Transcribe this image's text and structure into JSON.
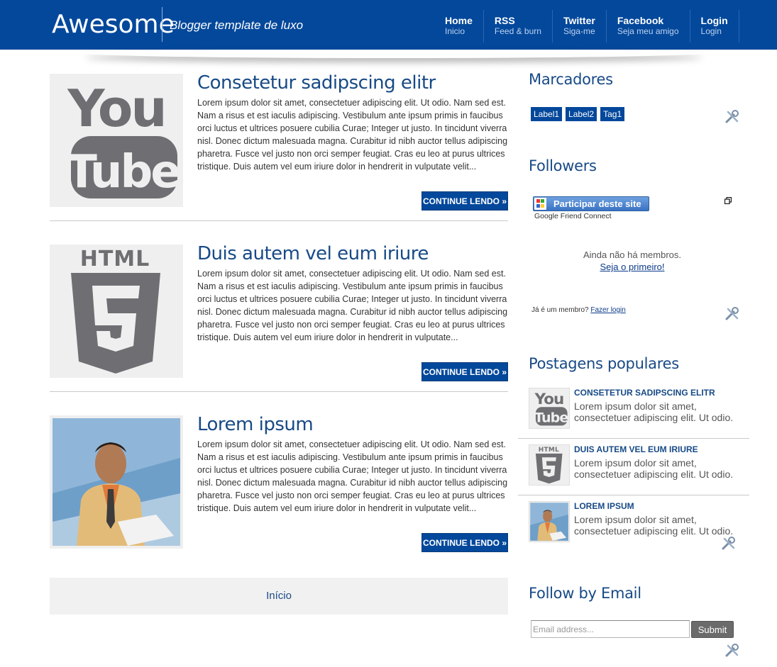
{
  "header": {
    "brand": "Awesome",
    "tagline": "Blogger template de luxo",
    "nav": [
      {
        "title": "Home",
        "subtitle": "Inicio"
      },
      {
        "title": "RSS",
        "subtitle": "Feed & burn"
      },
      {
        "title": "Twitter",
        "subtitle": "Siga-me"
      },
      {
        "title": "Facebook",
        "subtitle": "Seja meu amigo"
      },
      {
        "title": "Login",
        "subtitle": "Login"
      }
    ]
  },
  "posts": [
    {
      "title": "Consetetur sadipscing elitr",
      "thumb_icon": "youtube-logo-icon",
      "body": "Lorem ipsum dolor sit amet, consectetuer adipiscing elit. Ut odio. Nam sed est. Nam a risus et est iaculis adipiscing. Vestibulum ante ipsum primis in faucibus orci luctus et ultrices posuere cubilia Curae; Integer ut justo. In tincidunt viverra nisl. Donec dictum malesuada magna. Curabitur id nibh auctor tellus adipiscing pharetra. Fusce vel justo non orci semper feugiat. Cras eu leo at purus ultrices tristique. Duis autem vel eum iriure dolor in hendrerit in vulputate velit...",
      "more_label": "CONTINUE LENDO »"
    },
    {
      "title": "Duis autem vel eum iriure",
      "thumb_icon": "html5-logo-icon",
      "body": "Lorem ipsum dolor sit amet, consectetuer adipiscing elit. Ut odio. Nam sed est. Nam a risus et est iaculis adipiscing. Vestibulum ante ipsum primis in faucibus orci luctus et ultrices posuere cubilia Curae; Integer ut justo. In tincidunt viverra nisl. Donec dictum malesuada magna. Curabitur id nibh auctor tellus adipiscing pharetra. Fusce vel justo non orci semper feugiat. Cras eu leo at purus ultrices tristique. Duis autem vel eum iriure dolor in hendrerit in vulputate...",
      "more_label": "CONTINUE LENDO »"
    },
    {
      "title": "Lorem ipsum",
      "thumb_icon": "person-photo",
      "body": "Lorem ipsum dolor sit amet, consectetuer adipiscing elit. Ut odio. Nam sed est. Nam a risus et est iaculis adipiscing. Vestibulum ante ipsum primis in faucibus orci luctus et ultrices posuere cubilia Curae; Integer ut justo. In tincidunt viverra nisl. Donec dictum malesuada magna. Curabitur id nibh auctor tellus adipiscing pharetra. Fusce vel justo non orci semper feugiat. Cras eu leo at purus ultrices tristique. Duis autem vel eum iriure dolor in hendrerit in vulputate velit...",
      "more_label": "CONTINUE LENDO »"
    }
  ],
  "pager": {
    "home_label": "Início"
  },
  "sidebar": {
    "labels_widget": {
      "title": "Marcadores",
      "labels": [
        "Label1",
        "Label2",
        "Tag1"
      ]
    },
    "followers_widget": {
      "title": "Followers",
      "join_button": "Participar deste site",
      "join_sub": "Google Friend Connect",
      "no_members": "Ainda não há membros.",
      "be_first": "Seja o primeiro!",
      "already_member": "Já é um membro?",
      "login_link": "Fazer login"
    },
    "popular_widget": {
      "title": "Postagens populares",
      "items": [
        {
          "title": "CONSETETUR SADIPSCING ELITR",
          "text": "Lorem ipsum dolor sit amet, consectetuer adipiscing elit. Ut odio."
        },
        {
          "title": "DUIS AUTEM VEL EUM IRIURE",
          "text": "Lorem ipsum dolor sit amet, consectetuer adipiscing elit. Ut odio."
        },
        {
          "title": "LOREM IPSUM",
          "text": "Lorem ipsum dolor sit amet, consectetuer adipiscing elit. Ut odio."
        }
      ]
    },
    "email_widget": {
      "title": "Follow by Email",
      "placeholder": "Email address...",
      "submit": "Submit"
    }
  },
  "colors": {
    "header_blue": "#03489b",
    "title_blue": "#174a86",
    "button_blue": "#03489b",
    "icon_gray": "#6f6f73"
  }
}
